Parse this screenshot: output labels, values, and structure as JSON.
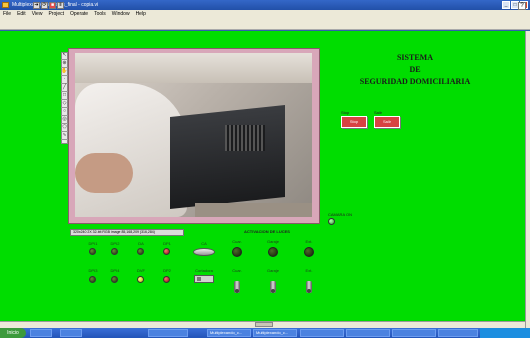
{
  "window": {
    "title": "Multiplexando_camaras_final - copia.vi",
    "controls": [
      "_",
      "□",
      "x"
    ]
  },
  "menu": [
    "File",
    "Edit",
    "View",
    "Project",
    "Operate",
    "Tools",
    "Window",
    "Help"
  ],
  "toolbar": {
    "icons": [
      "run-arrow-icon",
      "run-continuous-icon",
      "abort-icon",
      "pause-icon"
    ],
    "help": "?"
  },
  "panel": {
    "bg_color": "#00dd00",
    "title_lines": [
      "SISTEMA",
      "DE",
      "SEGURIDAD DOMICILIARIA"
    ],
    "video_caption": "320x240 2X 32-bit RGB image 85,168,209   (316,284)",
    "buttons": [
      {
        "top_label": "Stop",
        "label": "Stop"
      },
      {
        "top_label": "Salir",
        "label": "Salir"
      }
    ],
    "camera_led_label": "CAMARA ON",
    "section_label": "ACTIVACION DE LUCES",
    "leds_row1": [
      {
        "label": "DPI1",
        "color": "dark"
      },
      {
        "label": "DPI2",
        "color": "dark"
      },
      {
        "label": "DA",
        "color": "dark"
      },
      {
        "label": "DP1",
        "color": "red"
      }
    ],
    "leds_row2": [
      {
        "label": "DPI3",
        "color": "dark"
      },
      {
        "label": "DPI4",
        "color": "dark"
      },
      {
        "label": "DVF",
        "color": "yellow"
      },
      {
        "label": "DP2",
        "color": "red"
      }
    ],
    "switch_labels": [
      "CA",
      "Cortadora"
    ],
    "light_columns": [
      {
        "label": "Cuar."
      },
      {
        "label": "Garaje"
      },
      {
        "label": "Ext."
      }
    ]
  },
  "taskbar": {
    "start": "Inicio",
    "items": [
      "",
      "",
      "",
      "Multiplexando_c...",
      "Multiplexando_c...",
      "",
      "",
      "",
      ""
    ],
    "clock": ""
  }
}
